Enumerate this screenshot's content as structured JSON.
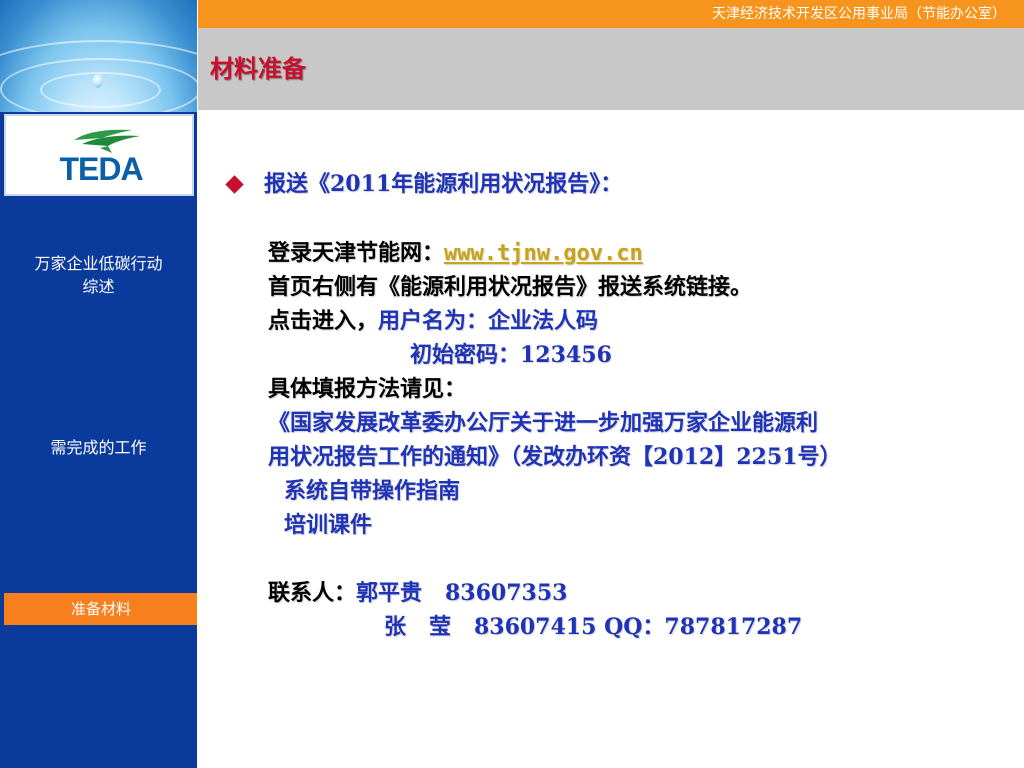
{
  "header": {
    "org_name": "天津经济技术开发区公用事业局（节能办公室）",
    "page_title": "材料准备"
  },
  "logo": {
    "text": "TEDA"
  },
  "sidebar": {
    "items": [
      {
        "label": "万家企业低碳行动"
      },
      {
        "label": "综述"
      },
      {
        "label": "需完成的工作"
      },
      {
        "label": "准备材料"
      }
    ]
  },
  "content": {
    "heading": "报送《2011年能源利用状况报告》：",
    "login_prefix": "登录天津节能网：",
    "login_url": "www.tjnw.gov.cn",
    "homepage_line": "首页右侧有《能源利用状况报告》报送系统链接。",
    "click_prefix": "点击进入，",
    "username_text": "用户名为：企业法人码",
    "password_text": "初始密码：123456",
    "method_line": "具体填报方法请见：",
    "notice_line1": "《国家发展改革委办公厅关于进一步加强万家企业能源利",
    "notice_line2": "用状况报告工作的通知》（发改办环资【2012】2251号）",
    "guide_line": "系统自带操作指南",
    "training_line": "培训课件",
    "contact_label": "联系人：",
    "contact1": "郭平贵   83607353",
    "contact2": "张   莹   83607415 QQ：787817287"
  },
  "colors": {
    "top_bar": "#f7941d",
    "title_bar": "#c8c8c8",
    "sidebar": "#0a3a9c",
    "active_nav": "#f77f1e",
    "title_red": "#c8102e",
    "text_blue": "#1f33b8",
    "link_gold": "#c8a416"
  },
  "icons": {
    "bullet": "diamond-bullet-icon",
    "logo_mark": "teda-leaf-icon"
  }
}
